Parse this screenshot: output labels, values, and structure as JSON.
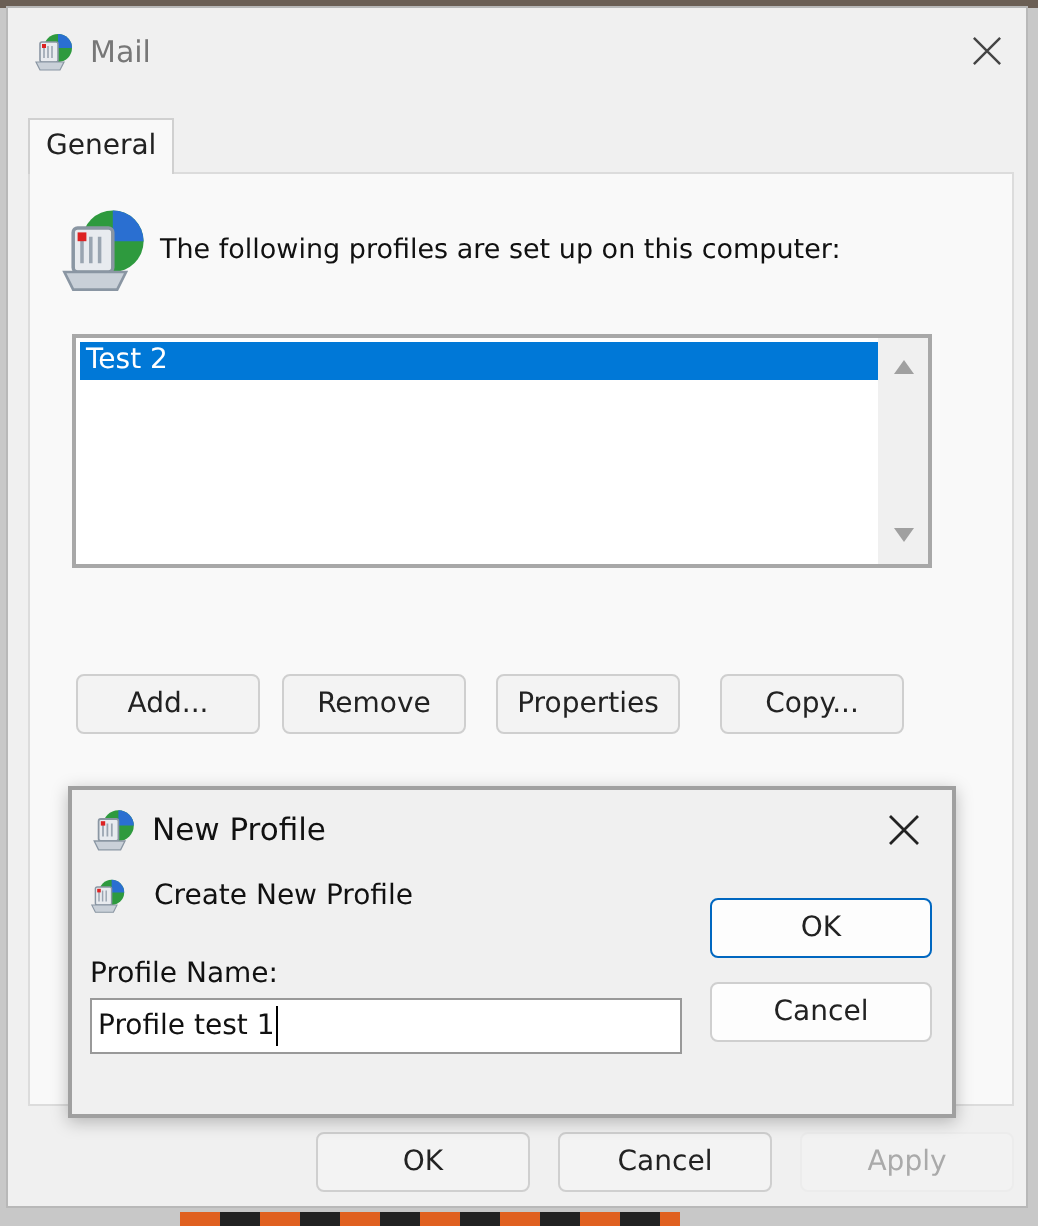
{
  "window": {
    "title": "Mail"
  },
  "tabs": [
    {
      "label": "General",
      "selected": true
    }
  ],
  "heading": "The following profiles are set up on this computer:",
  "profiles": [
    {
      "name": "Test 2",
      "selected": true
    }
  ],
  "profile_buttons": [
    "Add...",
    "Remove",
    "Properties",
    "Copy..."
  ],
  "dialog_buttons": [
    {
      "label": "OK",
      "disabled": false
    },
    {
      "label": "Cancel",
      "disabled": false
    },
    {
      "label": "Apply",
      "disabled": true
    }
  ],
  "new_profile": {
    "title": "New Profile",
    "heading": "Create New Profile",
    "field_label": "Profile Name:",
    "value": "Profile test 1",
    "buttons": [
      {
        "label": "OK",
        "default": true
      },
      {
        "label": "Cancel",
        "default": false
      }
    ]
  }
}
